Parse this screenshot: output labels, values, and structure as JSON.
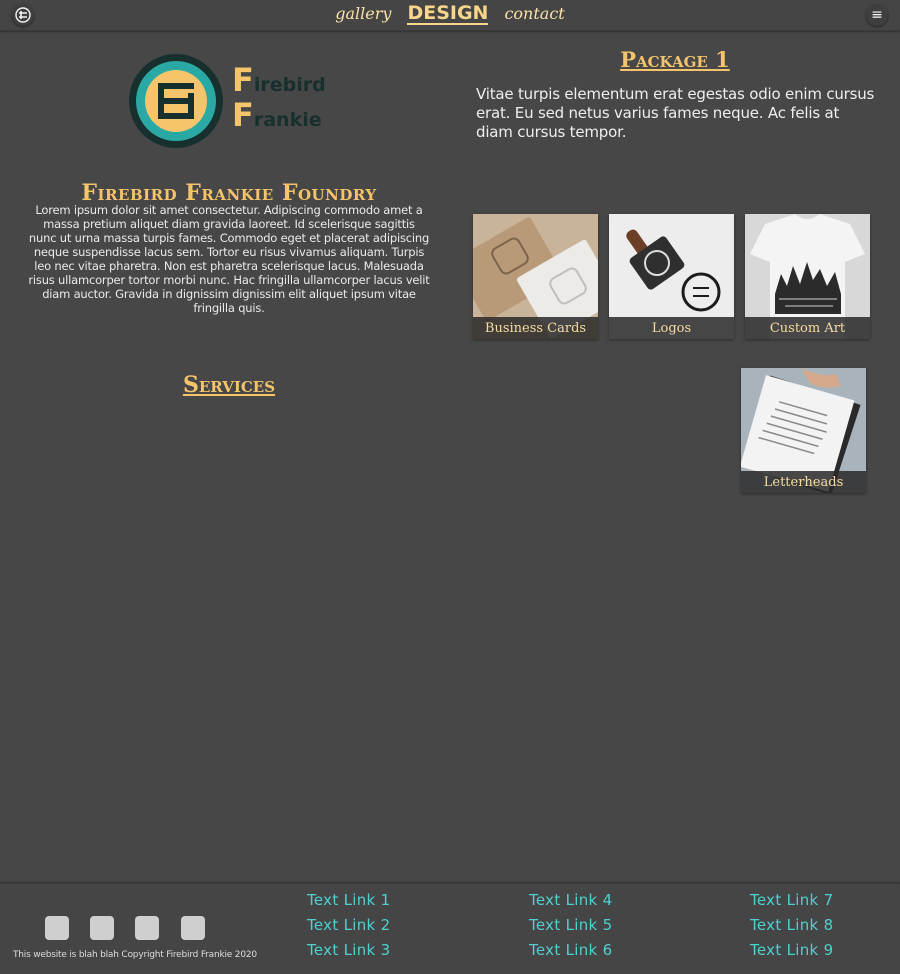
{
  "nav": {
    "home_icon": "firebird-monogram-icon",
    "links": [
      "gallery",
      "DESIGN",
      "contact"
    ],
    "active": "DESIGN",
    "menu_icon": "hamburger-icon",
    "menu_glyph": "≡"
  },
  "logo": {
    "line1": "irebird",
    "line2": "rankie",
    "initial1": "F",
    "initial2": "F",
    "accent": "#f6c56b",
    "ring": "#2aa9a4"
  },
  "foundry": {
    "title": "Firebird Frankie Foundry",
    "text": "Lorem ipsum dolor sit amet consectetur. Adipiscing commodo amet a massa pretium aliquet diam gravida laoreet. Id scelerisque sagittis nunc ut urna massa turpis fames. Commodo eget et placerat adipiscing neque suspendisse lacus sem. Tortor eu risus vivamus aliquam. Turpis leo nec vitae pharetra. Non est pharetra scelerisque lacus. Malesuada risus ullamcorper tortor morbi nunc. Hac fringilla ullamcorper lacus velit diam auctor. Gravida in dignissim dignissim elit aliquet ipsum vitae fringilla quis."
  },
  "services": {
    "title": "Services"
  },
  "package": {
    "title": "Package 1",
    "text": "Vitae turpis elementum erat egestas odio enim cursus erat. Eu sed netus varius fames neque. Ac felis at diam cursus tempor."
  },
  "cards": [
    {
      "label": "Business Cards",
      "image": "business-cards-photo"
    },
    {
      "label": "Logos",
      "image": "logo-stamp-photo"
    },
    {
      "label": "Custom Art",
      "image": "tshirt-art-photo"
    },
    {
      "label": "Letterheads",
      "image": "letterhead-photo"
    }
  ],
  "footer": {
    "social_icons": [
      "social-icon-1",
      "social-icon-2",
      "social-icon-3",
      "social-icon-4"
    ],
    "copyright": "This website is blah blah Copyright Firebird Frankie 2020",
    "links": [
      "Text Link 1",
      "Text Link 2",
      "Text Link 3",
      "Text Link 4",
      "Text Link 5",
      "Text Link 6",
      "Text Link 7",
      "Text Link 8",
      "Text Link 9"
    ],
    "link_color": "#4fd0d0"
  }
}
